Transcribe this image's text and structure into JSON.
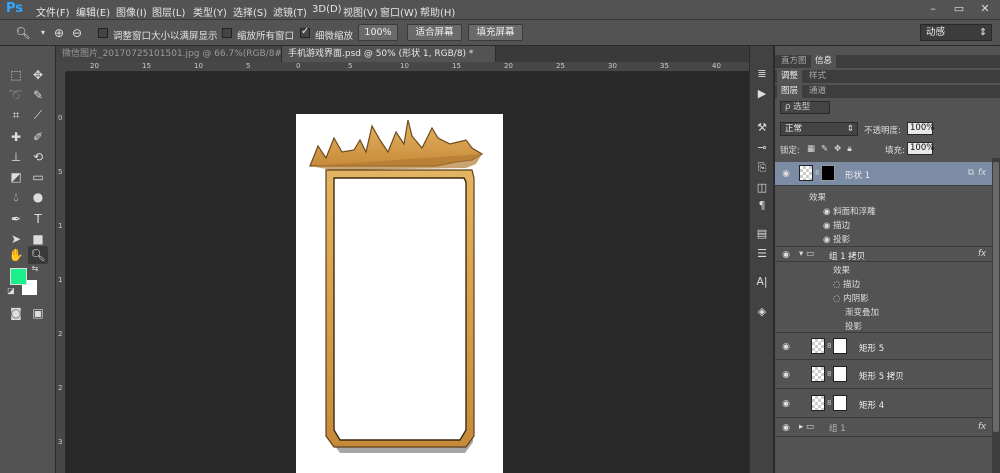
{
  "app": {
    "logo": "Ps"
  },
  "menu": [
    "文件(F)",
    "编辑(E)",
    "图像(I)",
    "图层(L)",
    "类型(Y)",
    "选择(S)",
    "滤镜(T)",
    "3D(D)",
    "视图(V)",
    "窗口(W)",
    "帮助(H)"
  ],
  "window_controls": [
    "–",
    "▭",
    "✕"
  ],
  "options_bar": {
    "resize_windows_label": "调整窗口大小以满屏显示",
    "resize_windows_checked": false,
    "zoom_all_label": "缩放所有窗口",
    "zoom_all_checked": false,
    "scrubby_zoom_label": "细微缩放",
    "scrubby_zoom_checked": true,
    "btn_100": "100%",
    "btn_fit": "适合屏幕",
    "btn_fill": "填充屏幕",
    "workspace": "动感"
  },
  "doc_tabs": [
    {
      "label": "微信图片_20170725101501.jpg @ 66.7%(RGB/8#) *",
      "active": false
    },
    {
      "label": "手机游戏界面.psd @ 50% (形状 1, RGB/8) *",
      "active": true
    }
  ],
  "rulers": {
    "h_ticks": [
      "20",
      "15",
      "10",
      "5",
      "0",
      "5",
      "10",
      "15",
      "20",
      "25",
      "30",
      "35",
      "40"
    ],
    "v_ticks": [
      "0",
      "5",
      "1",
      "1",
      "2",
      "2",
      "3"
    ]
  },
  "colors": {
    "foreground": "#19f08a",
    "background": "#ffffff",
    "gold": "#d9a553"
  },
  "panels": {
    "top_tabs": [
      "直方图",
      "信息"
    ],
    "mid_tabs": [
      "调整",
      "样式"
    ],
    "layer_tabs": [
      "图层",
      "通道"
    ],
    "filter_kind": "ρ 选型",
    "blend_mode": "正常",
    "opacity_label": "不透明度:",
    "opacity_value": "100%",
    "lock_label": "锁定:",
    "fill_label": "填充:",
    "fill_value": "100%"
  },
  "layers": {
    "shape1": {
      "name": "形状 1",
      "fx": "fx",
      "effects_label": "效果",
      "effects": [
        "斜面和浮雕",
        "描边",
        "投影"
      ]
    },
    "group_copy": {
      "name": "组 1 拷贝",
      "fx": "fx",
      "effects_label": "效果",
      "effects": [
        "描边",
        "内阴影",
        "渐变叠加",
        "投影"
      ]
    },
    "rect5": {
      "name": "矩形 5"
    },
    "rect5copy": {
      "name": "矩形 5 拷贝"
    },
    "rect4": {
      "name": "矩形 4"
    },
    "group_bottom": {
      "name": "组 1",
      "fx": "fx"
    }
  }
}
